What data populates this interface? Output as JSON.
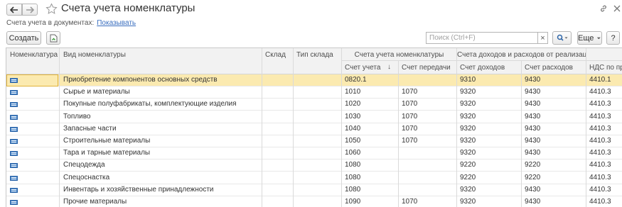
{
  "window": {
    "title": "Счета учета номенклатуры"
  },
  "docline": {
    "label": "Счета учета в документах:",
    "link": "Показывать"
  },
  "toolbar": {
    "create_label": "Создать",
    "search_placeholder": "Поиск (Ctrl+F)",
    "clear_label": "×",
    "more_label": "Еще",
    "help_label": "?"
  },
  "table": {
    "columns": {
      "nomenclature": "Номенклатура",
      "kind": "Вид номенклатуры",
      "warehouse": "Склад",
      "warehouse_type": "Тип склада",
      "group_accounts": "Счета учета номенклатуры",
      "account": "Счет учета",
      "transfer_account": "Счет передачи",
      "group_income": "Счета доходов и расходов от реализации",
      "income_account": "Счет доходов",
      "expense_account": "Счет расходов",
      "vat": "НДС по при"
    },
    "sort_indicator": "↓",
    "rows": [
      {
        "kind": "Приобретение компонентов основных средств",
        "account": "0820.1",
        "transfer": "",
        "income": "9310",
        "expense": "9430",
        "vat": "4410.1"
      },
      {
        "kind": "Сырье и материалы",
        "account": "1010",
        "transfer": "1070",
        "income": "9320",
        "expense": "9430",
        "vat": "4410.3"
      },
      {
        "kind": "Покупные полуфабрикаты, комплектующие изделия",
        "account": "1020",
        "transfer": "1070",
        "income": "9320",
        "expense": "9430",
        "vat": "4410.3"
      },
      {
        "kind": "Топливо",
        "account": "1030",
        "transfer": "1070",
        "income": "9320",
        "expense": "9430",
        "vat": "4410.3"
      },
      {
        "kind": "Запасные части",
        "account": "1040",
        "transfer": "1070",
        "income": "9320",
        "expense": "9430",
        "vat": "4410.3"
      },
      {
        "kind": "Строительные материалы",
        "account": "1050",
        "transfer": "1070",
        "income": "9320",
        "expense": "9430",
        "vat": "4410.3"
      },
      {
        "kind": "Тара и тарные материалы",
        "account": "1060",
        "transfer": "",
        "income": "9320",
        "expense": "9430",
        "vat": "4410.3"
      },
      {
        "kind": "Спецодежда",
        "account": "1080",
        "transfer": "",
        "income": "9220",
        "expense": "9220",
        "vat": "4410.3"
      },
      {
        "kind": "Спецоснастка",
        "account": "1080",
        "transfer": "",
        "income": "9220",
        "expense": "9220",
        "vat": "4410.3"
      },
      {
        "kind": "Инвентарь и хозяйственные принадлежности",
        "account": "1080",
        "transfer": "",
        "income": "9320",
        "expense": "9430",
        "vat": "4410.3"
      },
      {
        "kind": "Прочие материалы",
        "account": "1090",
        "transfer": "1070",
        "income": "9320",
        "expense": "9430",
        "vat": "4410.3"
      }
    ]
  },
  "icons": {
    "back": "arrow-left-icon",
    "forward": "arrow-right-icon",
    "favorite": "star-icon",
    "link": "link-icon",
    "close": "close-icon",
    "copy_file": "copy-file-icon",
    "search": "search-icon",
    "row": "list-item-icon"
  },
  "colors": {
    "selected_row": "#fbeab0",
    "link": "#3b6fbf",
    "accent": "#e0b23a"
  }
}
